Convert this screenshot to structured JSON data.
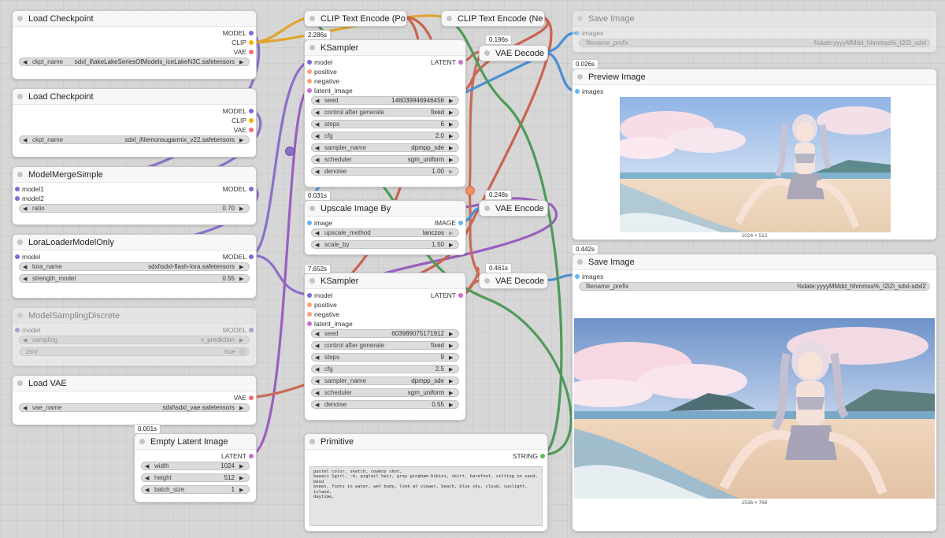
{
  "colors": {
    "model": "#7b6bd6",
    "clip": "#f0b400",
    "vae": "#ff6b6b",
    "latent": "#d06bd0",
    "conditioning": "#ffa07a",
    "image": "#64b5f6",
    "string": "#5cb85c"
  },
  "nodes": {
    "load_checkpoint_1": {
      "title": "Load Checkpoint",
      "outputs": [
        "MODEL",
        "CLIP",
        "VAE"
      ],
      "ckpt_label": "ckpt_name",
      "ckpt_value": "sdxl_il\\akeLakeSeriesOfModels_iceLakeN3C.safetensors"
    },
    "load_checkpoint_2": {
      "title": "Load Checkpoint",
      "outputs": [
        "MODEL",
        "CLIP",
        "VAE"
      ],
      "ckpt_label": "ckpt_name",
      "ckpt_value": "sdxl_il\\lemonsugarmix_v22.safetensors"
    },
    "model_merge": {
      "title": "ModelMergeSimple",
      "inputs": [
        "model1",
        "model2"
      ],
      "output": "MODEL",
      "ratio_label": "ratio",
      "ratio_value": "0.70"
    },
    "lora_loader": {
      "title": "LoraLoaderModelOnly",
      "input": "model",
      "output": "MODEL",
      "lora_label": "lora_name",
      "lora_value": "sdxl\\sdxl-flash-lora.safetensors",
      "strength_label": "strength_model",
      "strength_value": "0.55"
    },
    "model_sampling": {
      "title": "ModelSamplingDiscrete",
      "input": "model",
      "output": "MODEL",
      "sampling_label": "sampling",
      "sampling_value": "v_prediction",
      "zsnr_label": "zsnr",
      "zsnr_value": "true"
    },
    "load_vae": {
      "title": "Load VAE",
      "output": "VAE",
      "vae_label": "vae_name",
      "vae_value": "sdxl\\sdxl_vae.safetensors"
    },
    "empty_latent": {
      "badge": "0.001s",
      "title": "Empty Latent Image",
      "output": "LATENT",
      "width_label": "width",
      "width_value": "1024",
      "height_label": "height",
      "height_value": "512",
      "batch_label": "batch_size",
      "batch_value": "1"
    },
    "clip_pos": {
      "title": "CLIP Text Encode (Po"
    },
    "clip_neg": {
      "title": "CLIP Text Encode (Ne"
    },
    "ksampler_1": {
      "badge": "2.286s",
      "title": "KSampler",
      "inputs": [
        "model",
        "positive",
        "negative",
        "latent_image"
      ],
      "output": "LATENT",
      "widgets": [
        {
          "label": "seed",
          "value": "146039946946456"
        },
        {
          "label": "control after generate",
          "value": "fixed"
        },
        {
          "label": "steps",
          "value": "6"
        },
        {
          "label": "cfg",
          "value": "2.0"
        },
        {
          "label": "sampler_name",
          "value": "dpmpp_sde"
        },
        {
          "label": "scheduler",
          "value": "sgm_uniform"
        },
        {
          "label": "denoise",
          "value": "1.00"
        }
      ]
    },
    "upscale": {
      "badge": "0.031s",
      "title": "Upscale Image By",
      "input": "image",
      "output": "IMAGE",
      "method_label": "upscale_method",
      "method_value": "lanczos",
      "scale_label": "scale_by",
      "scale_value": "1.50"
    },
    "ksampler_2": {
      "badge": "7.652s",
      "title": "KSampler",
      "inputs": [
        "model",
        "positive",
        "negative",
        "latent_image"
      ],
      "output": "LATENT",
      "widgets": [
        {
          "label": "seed",
          "value": "603989075171912"
        },
        {
          "label": "control after generate",
          "value": "fixed"
        },
        {
          "label": "steps",
          "value": "9"
        },
        {
          "label": "cfg",
          "value": "2.5"
        },
        {
          "label": "sampler_name",
          "value": "dpmpp_sde"
        },
        {
          "label": "scheduler",
          "value": "sgm_uniform"
        },
        {
          "label": "denoise",
          "value": "0.55"
        }
      ]
    },
    "primitive": {
      "title": "Primitive",
      "output": "STRING",
      "text": "pastel color, sketch, cowboy shot,\nkawaii 1girl, :d, pigtail hair, gray gingham bikini, skirt, barefoot, sitting on sand, bend\nknees, foots in water, wet body, look at viewer, beach, blue sky, cloud, sunlight, island,\ndaytime,"
    },
    "vae_decode_1": {
      "badge": "0.196s",
      "title": "VAE Decode"
    },
    "vae_encode": {
      "badge": "0.248s",
      "title": "VAE Encode"
    },
    "vae_decode_2": {
      "badge": "0.461s",
      "title": "VAE Decode"
    },
    "save_image_top": {
      "title": "Save Image",
      "input": "images",
      "prefix_label": "filename_prefix",
      "prefix_value": "%date:yyyyMMdd_hhmmss%_t2i2i_sdxl"
    },
    "preview_image": {
      "badge": "0.026s",
      "title": "Preview Image",
      "input": "images",
      "dims": "1024 × 512"
    },
    "save_image": {
      "badge": "0.442s",
      "title": "Save Image",
      "input": "images",
      "prefix_label": "filename_prefix",
      "prefix_value": "%date:yyyyMMdd_hhmmss%_t2i2i_sdxl-sdxl2",
      "dims": "1536 × 768"
    }
  }
}
